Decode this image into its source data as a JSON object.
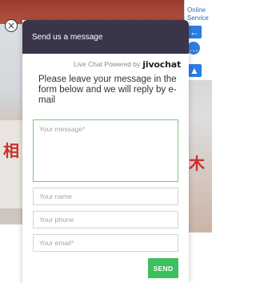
{
  "sidebar": {
    "online_service_label": "Online Service"
  },
  "widget": {
    "title": "Send us a message",
    "powered_by": "Live Chat Powered by",
    "brand": "jivochat",
    "intro": "Please leave your message in the form below and we will reply by e-mail",
    "message_placeholder": "Your message*",
    "name_placeholder": "Your name",
    "phone_placeholder": "Your phone",
    "email_placeholder": "Your email*",
    "send_label": "SEND"
  },
  "colors": {
    "header_bg": "#3a3548",
    "send_bg": "#3bbf5f",
    "message_border": "#7bc67a",
    "side_button": "#2b7de1"
  }
}
